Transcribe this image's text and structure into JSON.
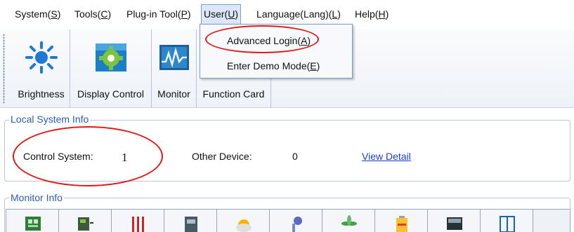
{
  "menu": [
    {
      "label": "System(",
      "hotkey": "S",
      "suffix": ")"
    },
    {
      "label": "Tools(",
      "hotkey": "C",
      "suffix": ")"
    },
    {
      "label": "Plug-in Tool(",
      "hotkey": "P",
      "suffix": ")"
    },
    {
      "label": "User(",
      "hotkey": "U",
      "suffix": ")"
    },
    {
      "label": "Language(Lang)(",
      "hotkey": "L",
      "suffix": ")"
    },
    {
      "label": "Help(",
      "hotkey": "H",
      "suffix": ")"
    }
  ],
  "dropdown": {
    "items": [
      {
        "label": "Advanced Login(",
        "hotkey": "A",
        "suffix": ")"
      },
      {
        "label": "Enter Demo Mode(",
        "hotkey": "E",
        "suffix": ")"
      }
    ]
  },
  "toolbar": {
    "tools": [
      {
        "label": "Brightness",
        "icon": "brightness-sun-icon"
      },
      {
        "label": "Display Control",
        "icon": "display-control-icon"
      },
      {
        "label": "Monitor",
        "icon": "monitor-wave-icon"
      },
      {
        "label": "Function Card",
        "icon": "function-card-icon"
      }
    ]
  },
  "local_system": {
    "title": "Local System Info",
    "control_system_label": "Control System:",
    "control_system_value": "1",
    "other_device_label": "Other Device:",
    "other_device_value": "0",
    "view_detail": "View Detail"
  },
  "monitor_info": {
    "title": "Monitor Info",
    "icons": [
      "board-icon",
      "card-icon",
      "temperature-icon",
      "device-icon",
      "weather-icon",
      "probe-icon",
      "fan-icon",
      "battery-icon",
      "screen-icon",
      "door-icon"
    ]
  },
  "colors": {
    "accent": "#2a5fb0",
    "link": "#1a3fd0",
    "highlight_ring": "#e01818"
  }
}
